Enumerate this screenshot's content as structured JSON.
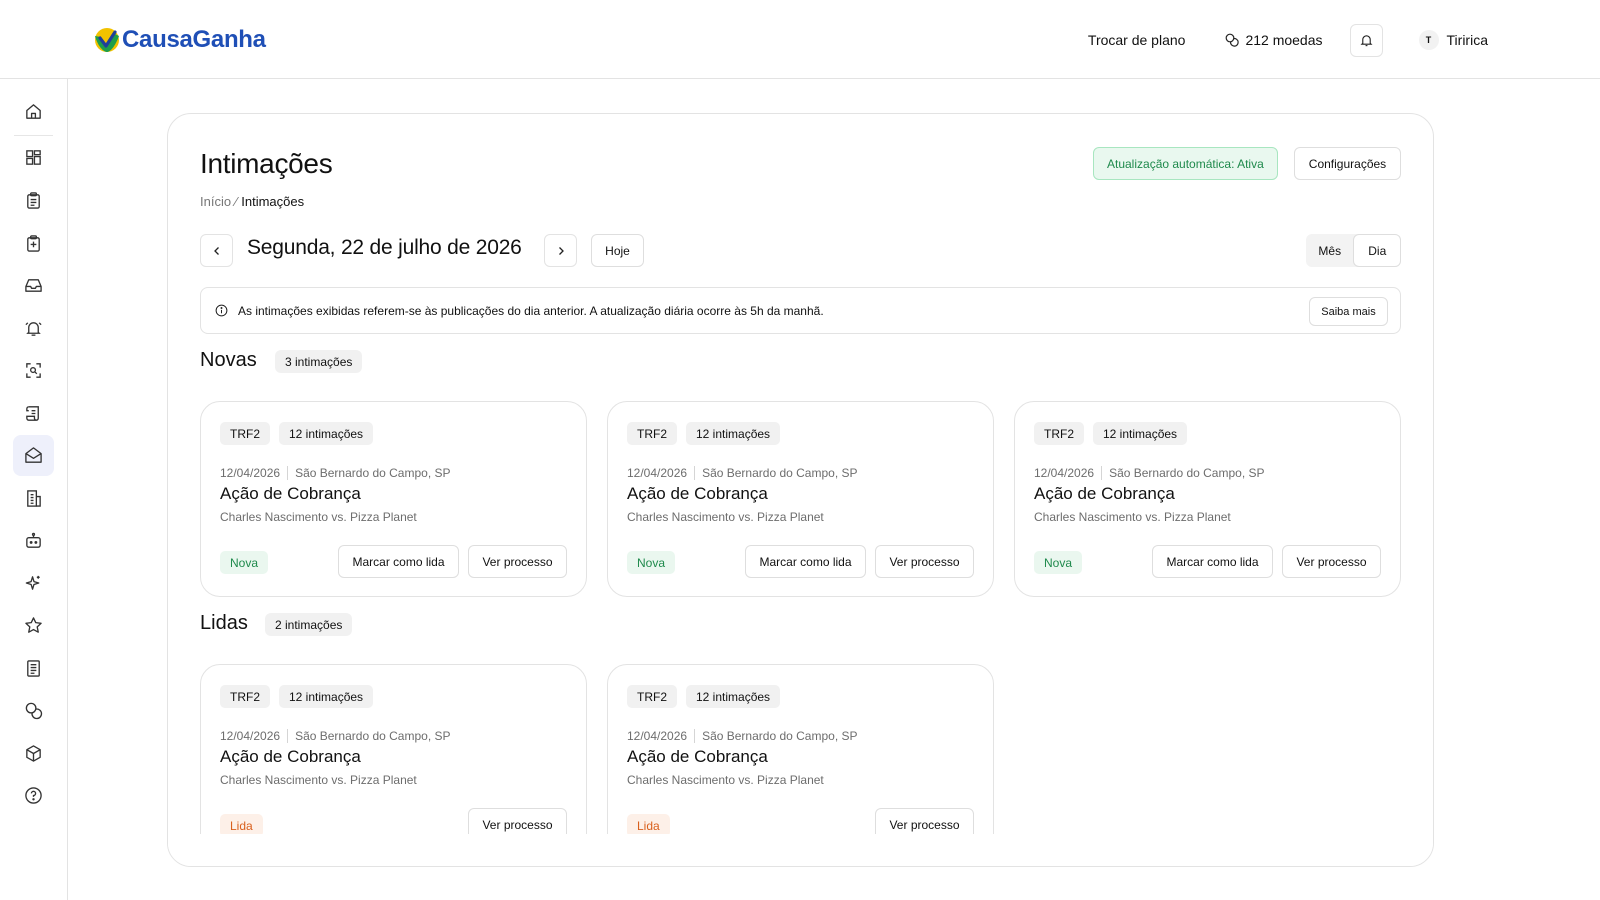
{
  "header": {
    "brand": "CausaGanha",
    "change_plan": "Trocar de plano",
    "coins": "212 moedas",
    "user_initial": "T",
    "user_name": "Tiririca"
  },
  "sidebar": {
    "items": [
      {
        "icon": "home-icon"
      },
      {
        "icon": "dashboard-icon"
      },
      {
        "icon": "clipboard-icon"
      },
      {
        "icon": "clipboard-plus-icon"
      },
      {
        "icon": "inbox-icon"
      },
      {
        "icon": "alarm-bell-icon"
      },
      {
        "icon": "scan-search-icon"
      },
      {
        "icon": "scroll-icon"
      },
      {
        "icon": "mail-open-icon",
        "active": true
      },
      {
        "icon": "building-icon"
      },
      {
        "icon": "bot-icon"
      },
      {
        "icon": "sparkles-icon"
      },
      {
        "icon": "star-icon"
      },
      {
        "icon": "notebook-icon"
      },
      {
        "icon": "coins-icon"
      },
      {
        "icon": "package-icon"
      },
      {
        "icon": "help-circle-icon"
      }
    ]
  },
  "page": {
    "title": "Intimações",
    "breadcrumb_home": "Início",
    "breadcrumb_sep": "⁄",
    "breadcrumb_current": "Intimações",
    "auto_update": "Atualização automática: Ativa",
    "settings": "Configurações",
    "date": "Segunda, 22 de julho de 2026",
    "today": "Hoje",
    "view_month": "Mês",
    "view_day": "Dia",
    "info": "As intimações exibidas referem-se às publicações do dia anterior. A atualização diária ocorre às 5h da manhã.",
    "learn_more": "Saiba mais"
  },
  "sections": {
    "new_title": "Novas",
    "new_count": "3 intimações",
    "read_title": "Lidas",
    "read_count": "2 intimações"
  },
  "new_cards": [
    {
      "court": "TRF2",
      "count": "12 intimações",
      "date": "12/04/2026",
      "location": "São Bernardo do Campo, SP",
      "title": "Ação de Cobrança",
      "parties": "Charles Nascimento vs. Pizza Planet",
      "status": "Nova",
      "mark_read": "Marcar como lida",
      "view": "Ver processo"
    },
    {
      "court": "TRF2",
      "count": "12 intimações",
      "date": "12/04/2026",
      "location": "São Bernardo do Campo, SP",
      "title": "Ação de Cobrança",
      "parties": "Charles Nascimento vs. Pizza Planet",
      "status": "Nova",
      "mark_read": "Marcar como lida",
      "view": "Ver processo"
    },
    {
      "court": "TRF2",
      "count": "12 intimações",
      "date": "12/04/2026",
      "location": "São Bernardo do Campo, SP",
      "title": "Ação de Cobrança",
      "parties": "Charles Nascimento vs. Pizza Planet",
      "status": "Nova",
      "mark_read": "Marcar como lida",
      "view": "Ver processo"
    }
  ],
  "read_cards": [
    {
      "court": "TRF2",
      "count": "12 intimações",
      "date": "12/04/2026",
      "location": "São Bernardo do Campo, SP",
      "title": "Ação de Cobrança",
      "parties": "Charles Nascimento vs. Pizza Planet",
      "status": "Lida",
      "view": "Ver processo"
    },
    {
      "court": "TRF2",
      "count": "12 intimações",
      "date": "12/04/2026",
      "location": "São Bernardo do Campo, SP",
      "title": "Ação de Cobrança",
      "parties": "Charles Nascimento vs. Pizza Planet",
      "status": "Lida",
      "view": "Ver processo"
    }
  ],
  "colors": {
    "brand_blue": "#1f4fb6",
    "success_green": "#1f8a4c",
    "read_orange": "#d9601d"
  }
}
